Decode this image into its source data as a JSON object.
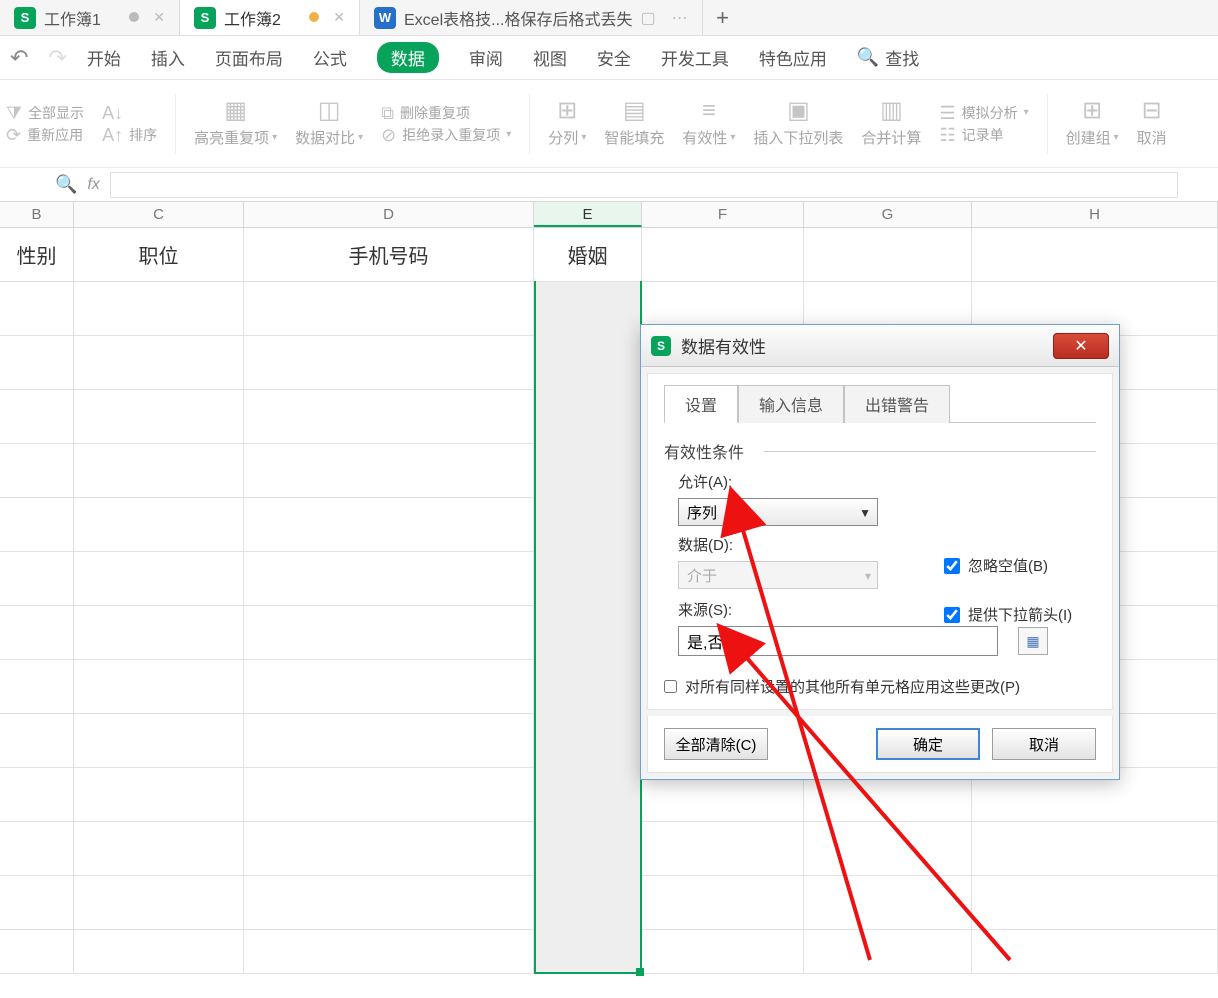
{
  "tabs": {
    "items": [
      {
        "label": "工作簿1"
      },
      {
        "label": "工作簿2"
      },
      {
        "label": "Excel表格技...格保存后格式丢失"
      }
    ]
  },
  "ribbon": {
    "items": [
      "开始",
      "插入",
      "页面布局",
      "公式",
      "数据",
      "审阅",
      "视图",
      "安全",
      "开发工具",
      "特色应用"
    ],
    "search": "查找"
  },
  "toolbar": {
    "full_show": "全部显示",
    "reapply": "重新应用",
    "sort": "排序",
    "highlight_dup": "高亮重复项",
    "data_compare": "数据对比",
    "del_dup": "删除重复项",
    "reject_dup": "拒绝录入重复项",
    "split": "分列",
    "smart_fill": "智能填充",
    "validity": "有效性",
    "ins_dropdown": "插入下拉列表",
    "merge_calc": "合并计算",
    "record": "记录单",
    "sim": "模拟分析",
    "create_group": "创建组",
    "ungroup": "取消"
  },
  "columns": {
    "B": "B",
    "C": "C",
    "D": "D",
    "E": "E",
    "F": "F",
    "G": "G",
    "H": "H"
  },
  "headers": {
    "B": "性别",
    "C": "职位",
    "D": "手机号码",
    "E": "婚姻"
  },
  "dialog": {
    "title": "数据有效性",
    "tabs": [
      "设置",
      "输入信息",
      "出错警告"
    ],
    "fieldset": "有效性条件",
    "allow_label": "允许(A):",
    "allow_value": "序列",
    "ignore_blank": "忽略空值(B)",
    "dropdown": "提供下拉箭头(I)",
    "data_label": "数据(D):",
    "data_value": "介于",
    "source_label": "来源(S):",
    "source_value": "是,否",
    "apply_all": "对所有同样设置的其他所有单元格应用这些更改(P)",
    "clear": "全部清除(C)",
    "ok": "确定",
    "cancel": "取消"
  }
}
